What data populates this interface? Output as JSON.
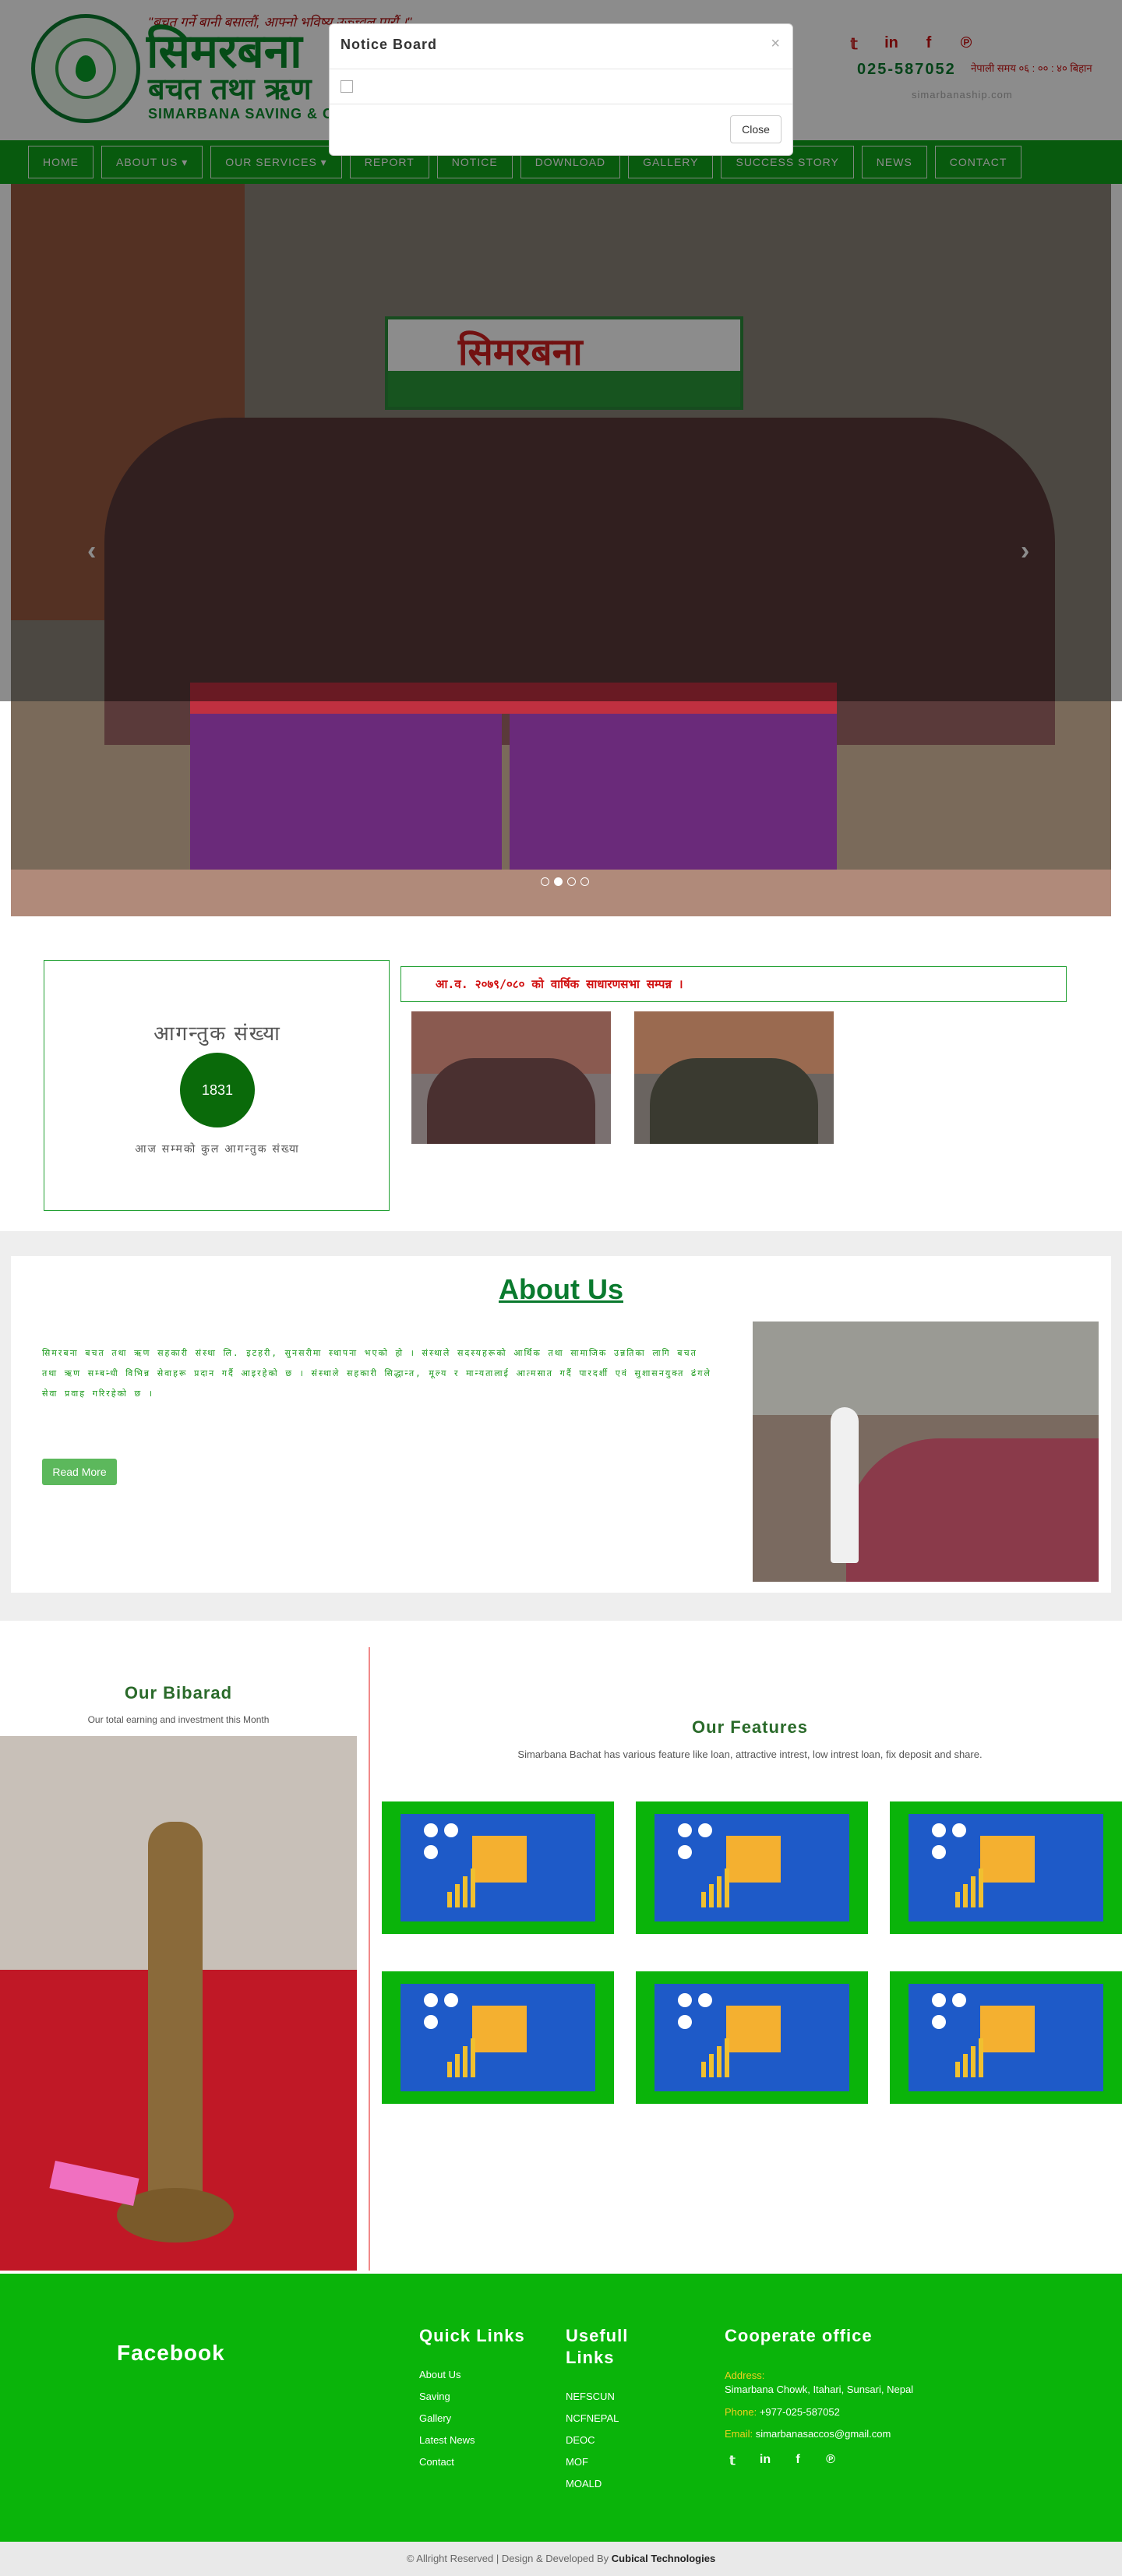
{
  "header": {
    "slogan": "\"बचत गर्ने बानी बसालौं, आफ्नो भविष्य उज्ज्वल पारौं ।\"",
    "org_name_np": "सिमरबना",
    "org_sub_np": "बचत तथा ऋण",
    "org_name_en": "SIMARBANA SAVING & CREDIT",
    "social_icons": [
      "twitter-icon",
      "linkedin-icon",
      "facebook-icon",
      "pinterest-icon"
    ],
    "phone": "025-587052",
    "hours": "नेपाली समय ०६ : ०० : ४० बिहान",
    "website": "simarbanaship.com"
  },
  "nav": {
    "items": [
      {
        "label": "HOME"
      },
      {
        "label": "ABOUT US ▾"
      },
      {
        "label": "OUR SERVICES ▾"
      },
      {
        "label": "REPORT"
      },
      {
        "label": "NOTICE"
      },
      {
        "label": "DOWNLOAD"
      },
      {
        "label": "GALLERY"
      },
      {
        "label": "SUCCESS STORY"
      },
      {
        "label": "NEWS"
      },
      {
        "label": "CONTACT"
      }
    ]
  },
  "slider": {
    "banner_text": "सिमरबना",
    "prev": "‹",
    "next": "›",
    "active_index": 1,
    "dot_count": 4
  },
  "modal": {
    "title": "Notice Board",
    "close_x": "×",
    "close_button": "Close"
  },
  "visitor": {
    "heading": "आगन्तुक संख्या",
    "count": "1831",
    "subtext": "आज सम्मको कुल आगन्तुक संख्या"
  },
  "ticker": {
    "text": "आ.व. २०७९/०८० को वार्षिक साधारणसभा सम्पन्न ।"
  },
  "about": {
    "title": "About Us",
    "text": "सिमरबना बचत तथा ऋण सहकारी संस्था लि. इटहरी, सुनसरीमा स्थापना भएको हो । संस्थाले सदस्यहरूको आर्थिक तथा सामाजिक उन्नतिका लागि बचत तथा ऋण सम्बन्धी विभिन्न सेवाहरू प्रदान गर्दै आइरहेको छ । संस्थाले सहकारी सिद्धान्त, मूल्य र मान्यतालाई आत्मसात गर्दै पारदर्शी एवं सुशासनयुक्त ढंगले सेवा प्रवाह गरिरहेको छ ।",
    "read_more": "Read More"
  },
  "bibarad": {
    "title": "Our Bibarad",
    "subtitle": "Our total earning and investment this Month"
  },
  "features": {
    "title": "Our Features",
    "subtitle": "Simarbana Bachat has various feature like loan, attractive intrest, low intrest loan, fix deposit and share.",
    "card_count": 6
  },
  "footer": {
    "facebook": "Facebook",
    "quick_title": "Quick Links",
    "quick_links": [
      "About Us",
      "Saving",
      "Gallery",
      "Latest News",
      "Contact"
    ],
    "useful_title": "Usefull Links",
    "useful_links": [
      "NEFSCUN",
      "NCFNEPAL",
      "DEOC",
      "MOF",
      "MOALD"
    ],
    "office_title": "Cooperate office",
    "address_label": "Address:",
    "address": "Simarbana Chowk, Itahari, Sunsari, Nepal",
    "phone_label": "Phone:",
    "phone": "+977-025-587052",
    "email_label": "Email:",
    "email": "simarbanasaccos@gmail.com",
    "social_icons": [
      "twitter-icon",
      "linkedin-icon",
      "facebook-icon",
      "pinterest-icon"
    ]
  },
  "bottom": {
    "text": "© Allright Reserved | Design & Developed By",
    "company": "Cubical Technologies"
  },
  "colors": {
    "brand_green": "#0ab40a",
    "nav_green": "#10a41a",
    "accent_red": "#c81010"
  }
}
